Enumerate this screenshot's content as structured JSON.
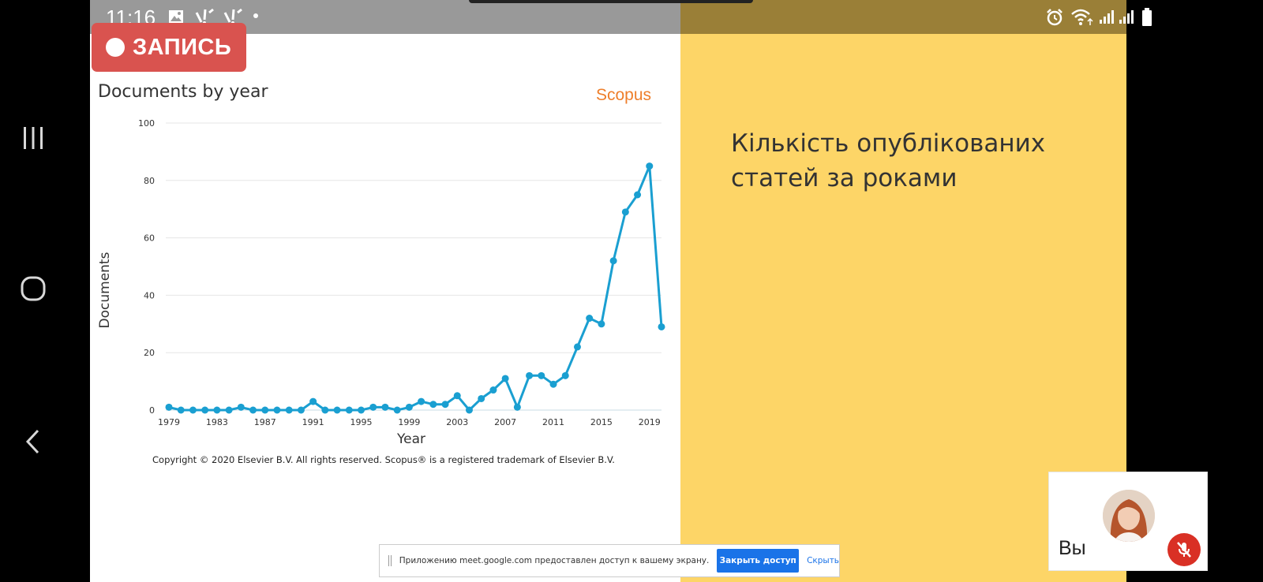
{
  "status_bar": {
    "time": "11:16",
    "left_icons": [
      "image-icon",
      "signal-icon",
      "signal-icon",
      "dot-icon"
    ],
    "right_icons": [
      "alarm-icon",
      "wifi-icon",
      "cell-signal-icon",
      "cell-signal-icon",
      "battery-icon"
    ]
  },
  "recording": {
    "label": "ЗАПИСЬ"
  },
  "chart_header": {
    "title": "Documents by year",
    "brand": "Scopus"
  },
  "chart_data": {
    "type": "line",
    "xlabel": "Year",
    "ylabel": "Documents",
    "ylim": [
      0,
      100
    ],
    "xlim": [
      1979,
      2020
    ],
    "yticks": [
      0,
      20,
      40,
      60,
      80,
      100
    ],
    "xticks": [
      1979,
      1983,
      1987,
      1991,
      1995,
      1999,
      2003,
      2007,
      2011,
      2015,
      2019
    ],
    "grid": true,
    "color": "#1a9fd1",
    "x": [
      1979,
      1980,
      1981,
      1982,
      1983,
      1984,
      1985,
      1986,
      1987,
      1988,
      1989,
      1990,
      1991,
      1992,
      1993,
      1994,
      1995,
      1996,
      1997,
      1998,
      1999,
      2000,
      2001,
      2002,
      2003,
      2004,
      2005,
      2006,
      2007,
      2008,
      2009,
      2010,
      2011,
      2012,
      2013,
      2014,
      2015,
      2016,
      2017,
      2018,
      2019,
      2020
    ],
    "y": [
      1,
      0,
      0,
      0,
      0,
      0,
      1,
      0,
      0,
      0,
      0,
      0,
      3,
      0,
      0,
      0,
      0,
      1,
      1,
      0,
      1,
      3,
      2,
      2,
      5,
      0,
      4,
      7,
      11,
      1,
      12,
      12,
      9,
      12,
      22,
      32,
      30,
      52,
      69,
      75,
      85,
      29
    ]
  },
  "copyright": "Copyright © 2020 Elsevier B.V. All rights reserved. Scopus® is a registered trademark of Elsevier B.V.",
  "slide_heading": "Кількість опублікованих статей за роками",
  "share_banner": {
    "text": "Приложению meet.google.com предоставлен доступ к вашему экрану.",
    "stop_label": "Закрыть доступ",
    "hide_label": "Скрыть"
  },
  "self_view": {
    "name": "Вы"
  }
}
